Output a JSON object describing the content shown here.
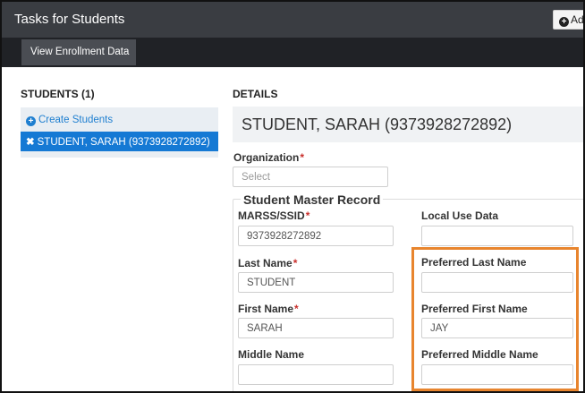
{
  "header": {
    "title": "Tasks for Students",
    "add_button_label": "Ad"
  },
  "subnav": {
    "tab_label": "View Enrollment Data"
  },
  "students": {
    "heading": "STUDENTS (1)",
    "create_link": "Create Students",
    "items": [
      {
        "label": "STUDENT, SARAH (9373928272892)"
      }
    ]
  },
  "details": {
    "heading": "DETAILS",
    "student_name": "STUDENT, SARAH (9373928272892)",
    "organization": {
      "label": "Organization",
      "required_mark": "*",
      "placeholder": "Select"
    },
    "section_title": "Student Master Record",
    "marss": {
      "label": "MARSS/SSID",
      "required_mark": "*",
      "value": "9373928272892"
    },
    "local_use": {
      "label": "Local Use Data",
      "value": ""
    },
    "last_name": {
      "label": "Last Name",
      "required_mark": "*",
      "value": "STUDENT"
    },
    "pref_last_name": {
      "label": "Preferred Last Name",
      "value": ""
    },
    "first_name": {
      "label": "First Name",
      "required_mark": "*",
      "value": "SARAH"
    },
    "pref_first_name": {
      "label": "Preferred First Name",
      "value": "JAY"
    },
    "middle_name": {
      "label": "Middle Name",
      "value": ""
    },
    "pref_middle_name": {
      "label": "Preferred Middle Name",
      "value": ""
    }
  },
  "colors": {
    "highlight": "#e8852e",
    "selected": "#1579d4",
    "link": "#1f7fd0",
    "required": "#c9302c"
  }
}
